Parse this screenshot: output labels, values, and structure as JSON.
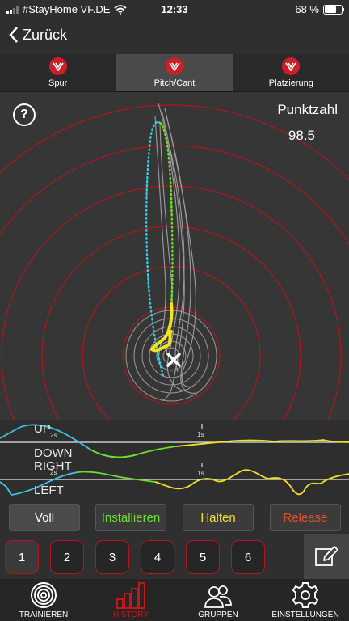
{
  "status": {
    "carrier": "#StayHome VF.DE",
    "time": "12:33",
    "battery": "68 %",
    "battery_level": 0.68
  },
  "nav": {
    "back_label": "Zurück"
  },
  "tabs": [
    {
      "label": "Spur",
      "active": false
    },
    {
      "label": "Pitch/Cant",
      "active": true
    },
    {
      "label": "Platzierung",
      "active": false
    }
  ],
  "target": {
    "help": "?",
    "score_label": "Punktzahl",
    "score_value": "98.5"
  },
  "graph": {
    "up": "UP",
    "down": "DOWN",
    "right": "RIGHT",
    "left": "LEFT",
    "tick_2s": "2s",
    "tick_1s": "1s"
  },
  "phases": {
    "full": "Voll",
    "install": "Installieren",
    "hold": "Halten",
    "release": "Release"
  },
  "shots": [
    "1",
    "2",
    "3",
    "4",
    "5",
    "6"
  ],
  "bottom_nav": [
    {
      "label": "TRAINIEREN",
      "active": false,
      "icon": "target-icon"
    },
    {
      "label": "HISTORY",
      "active": true,
      "icon": "bar-chart-icon"
    },
    {
      "label": "GRUPPEN",
      "active": false,
      "icon": "group-icon"
    },
    {
      "label": "EINSTELLUNGEN",
      "active": false,
      "icon": "gear-icon"
    }
  ],
  "colors": {
    "accent": "#cc2027",
    "cyan": "#3cc8e0",
    "green": "#6ee02a",
    "yellow": "#f2e21c",
    "release": "#e0502a"
  }
}
